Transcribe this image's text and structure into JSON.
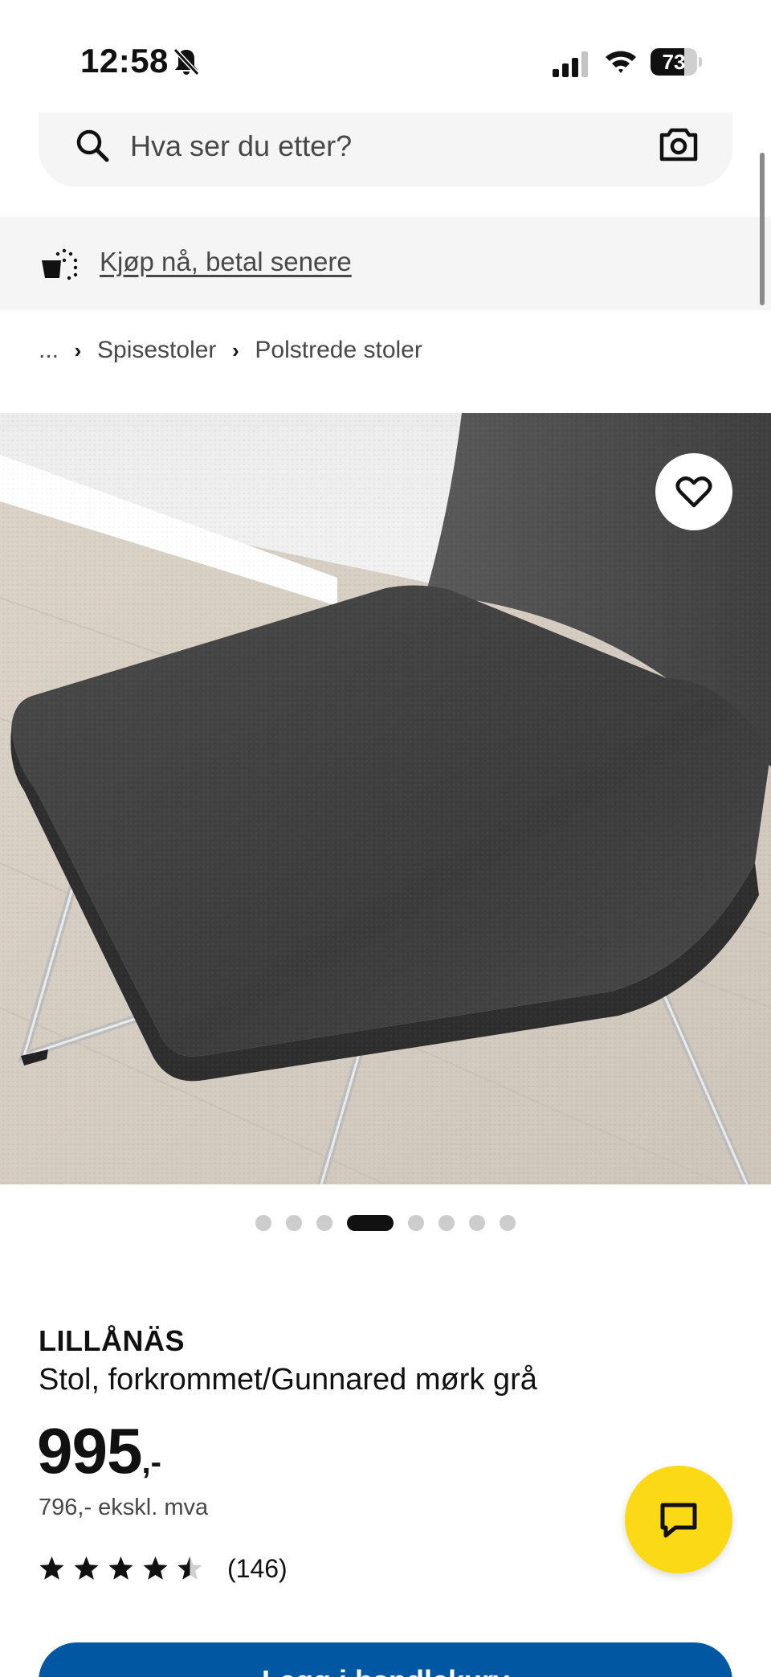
{
  "status_bar": {
    "time": "12:58",
    "battery": "73",
    "battery_level": 0.73
  },
  "search": {
    "placeholder": "Hva ser du etter?"
  },
  "promo": {
    "link_text": "Kjøp nå, betal senere"
  },
  "breadcrumb": {
    "items": [
      "...",
      "Spisestoler",
      "Polstrede stoler"
    ]
  },
  "carousel": {
    "count": 8,
    "active_index": 3
  },
  "product": {
    "name": "LILLÅNÄS",
    "description": "Stol, forkrommet/Gunnared mørk grå",
    "price": "995",
    "price_suffix": ",-",
    "price_ex_vat": "796,- ekskl. mva",
    "rating": 4.5,
    "review_count": "(146)"
  },
  "actions": {
    "add_to_cart_label": "Legg i handlekurv"
  },
  "colors": {
    "brand_blue": "#0058a3",
    "chat_yellow": "#fbd914",
    "text": "#111111",
    "muted": "#484848"
  },
  "icons": [
    "bell-off-icon",
    "signal-icon",
    "wifi-icon",
    "battery-icon",
    "search-icon",
    "camera-icon",
    "buy-now-pay-later-icon",
    "chevron-right-icon",
    "heart-icon",
    "star-icon",
    "chat-icon"
  ]
}
